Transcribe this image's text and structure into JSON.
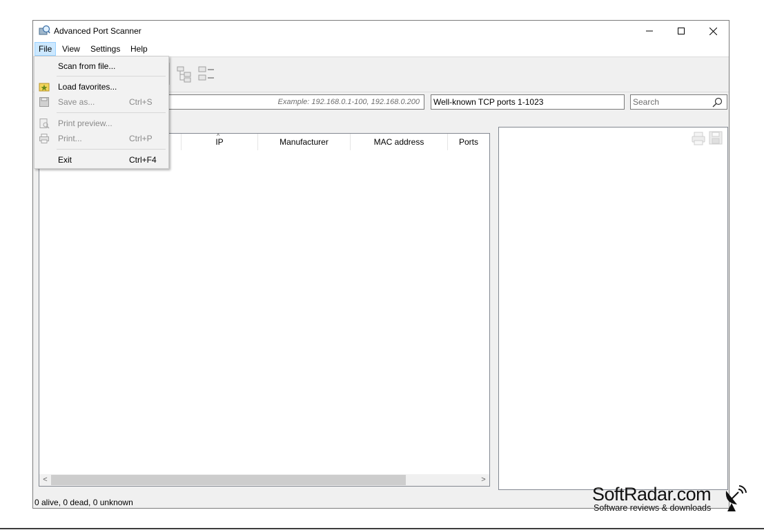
{
  "window": {
    "title": "Advanced Port Scanner"
  },
  "menubar": {
    "items": [
      "File",
      "View",
      "Settings",
      "Help"
    ]
  },
  "inputs": {
    "range_placeholder": "Example: 192.168.0.1-100, 192.168.0.200",
    "ports_value": "Well-known TCP ports 1-1023",
    "search_placeholder": "Search"
  },
  "results": {
    "columns": [
      "IP",
      "Manufacturer",
      "MAC address",
      "Ports"
    ]
  },
  "status": {
    "text": "0 alive, 0 dead, 0 unknown"
  },
  "file_menu": {
    "scan_from_file": "Scan from file...",
    "load_favorites": "Load favorites...",
    "save_as": "Save as...",
    "save_as_shortcut": "Ctrl+S",
    "print_preview": "Print preview...",
    "print": "Print...",
    "print_shortcut": "Ctrl+P",
    "exit": "Exit",
    "exit_shortcut": "Ctrl+F4"
  },
  "watermark": {
    "brand": "SoftRadar.com",
    "tagline": "Software reviews & downloads"
  },
  "colors": {
    "menu_highlight": "#cce8ff",
    "window_bg": "#f0f0f0"
  }
}
